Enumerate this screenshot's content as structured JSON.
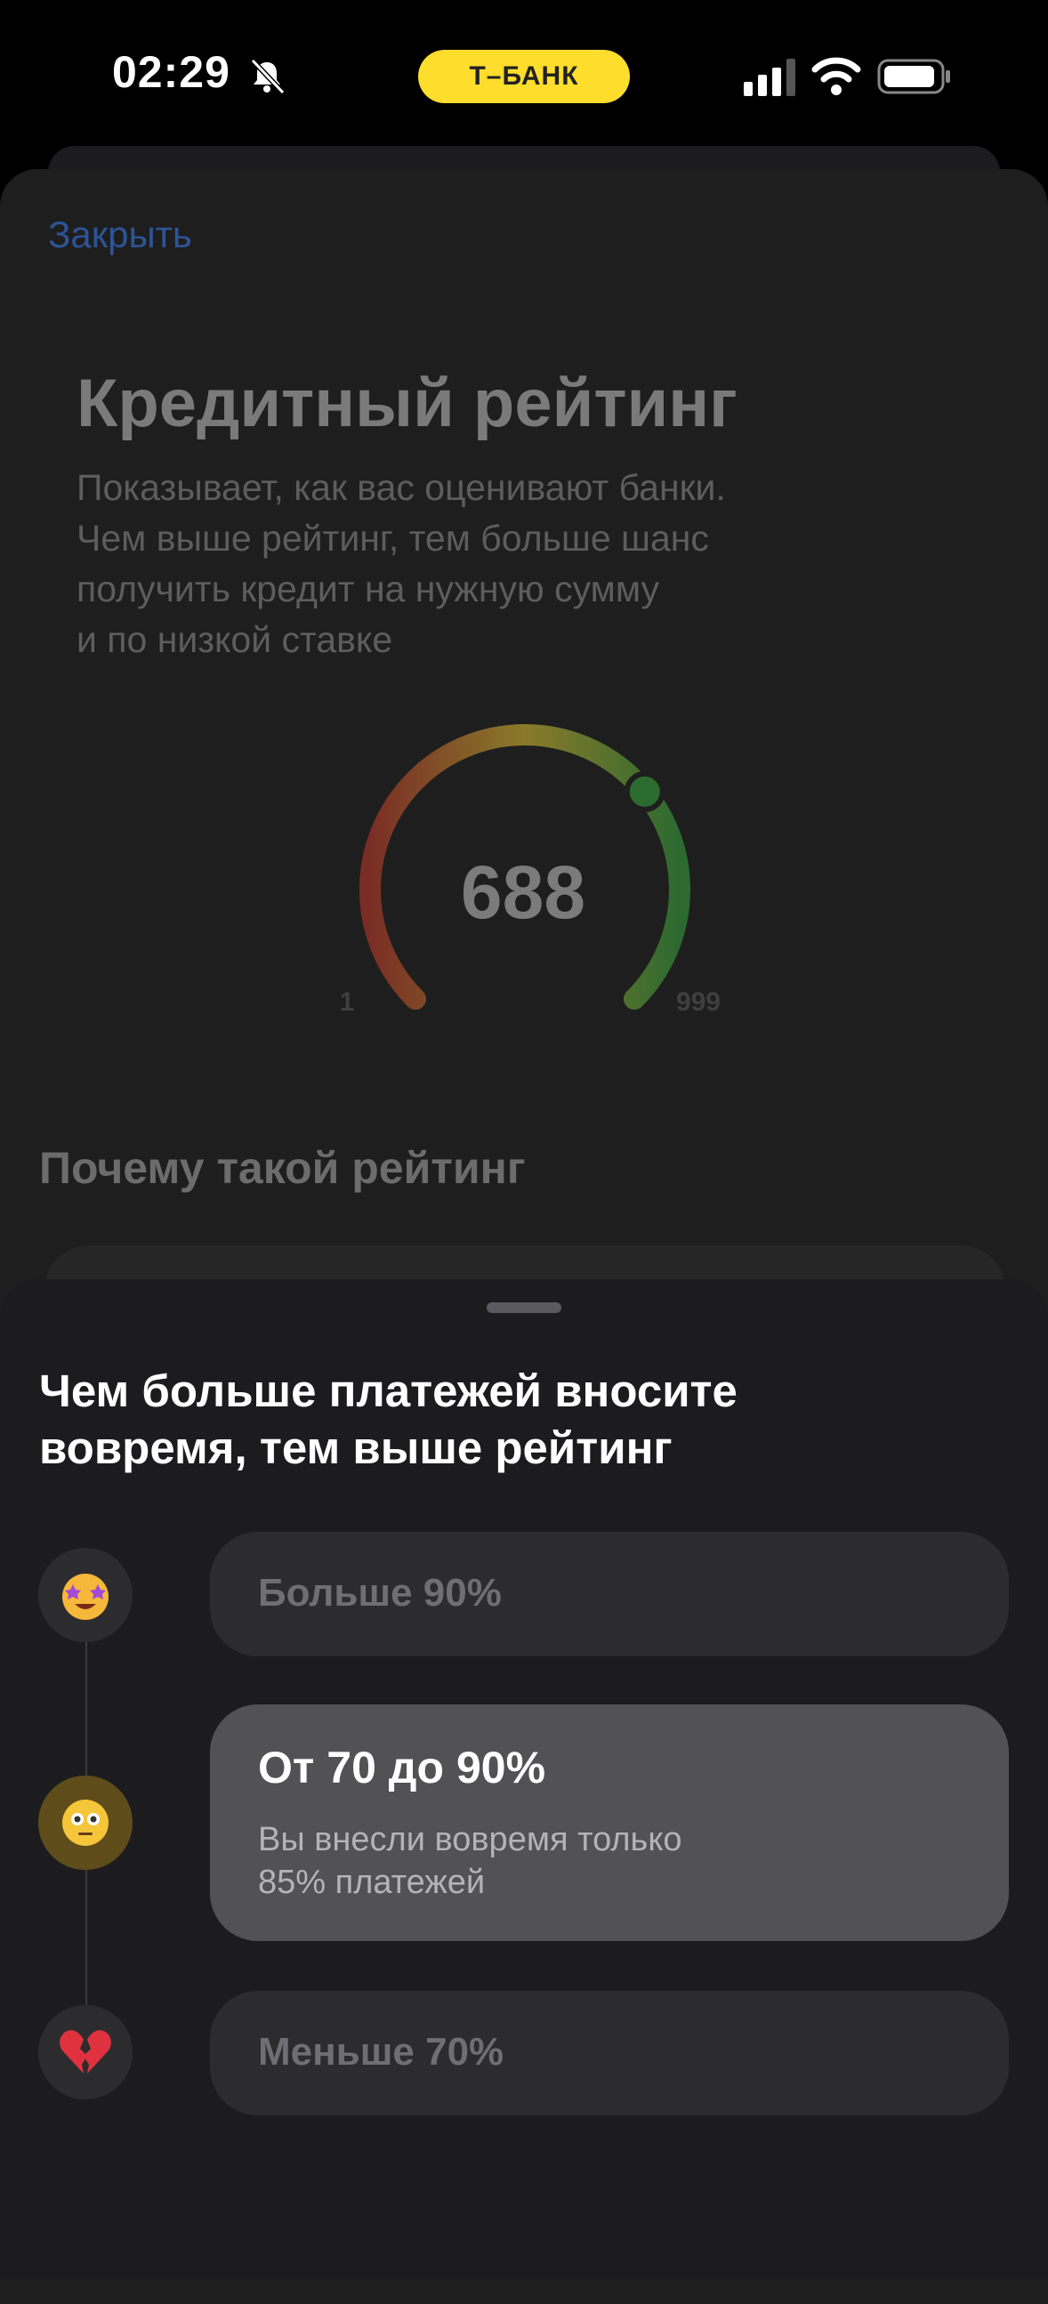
{
  "status_bar": {
    "time": "02:29",
    "bank_badge": "Т–БАНК",
    "badge_color": "#ffdd2d"
  },
  "background_screen": {
    "close_label": "Закрыть",
    "title": "Кредитный рейтинг",
    "description_lines": [
      "Показывает, как вас оценивают банки.",
      "Чем выше рейтинг, тем больше шанс",
      "получить кредит на нужную сумму",
      "и по низкой ставке"
    ],
    "gauge": {
      "value": "688",
      "min_label": "1",
      "max_label": "999",
      "level": 0.688,
      "colors": [
        "#b2352a",
        "#c8a92b",
        "#2e9b3f"
      ]
    },
    "section_title": "Почему такой рейтинг"
  },
  "bottom_sheet": {
    "title_lines": [
      "Чем больше платежей вносите",
      "вовремя, тем выше рейтинг"
    ],
    "options": [
      {
        "label": "Больше 90%",
        "icon": "star-struck-emoji-icon",
        "active": false
      },
      {
        "label": "От 70 до 90%",
        "icon": "flushed-face-emoji-icon",
        "active": true,
        "description_lines": [
          "Вы внесли вовремя только",
          "85% платежей"
        ]
      },
      {
        "label": "Меньше 70%",
        "icon": "broken-heart-emoji-icon",
        "active": false
      }
    ]
  }
}
